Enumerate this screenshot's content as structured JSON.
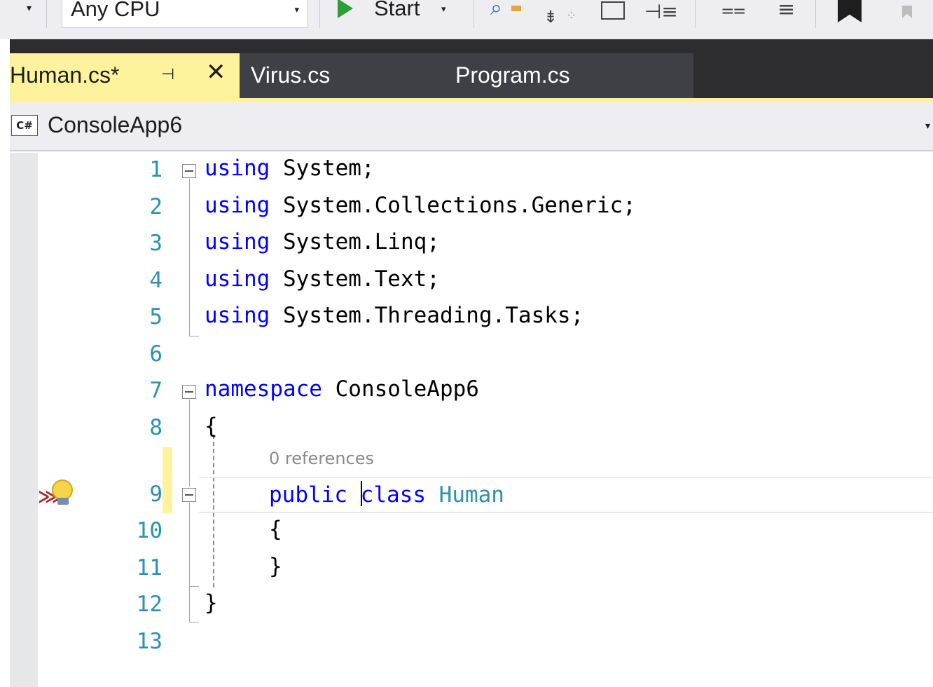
{
  "toolbar": {
    "platform_label": "Any CPU",
    "start_label": "Start",
    "dropdown_glyph": "▾",
    "icons": [
      "config-dropdown-icon",
      "find-icon",
      "format-document-icon",
      "comment-icon",
      "uncomment-icon",
      "outdent-icon",
      "indent-icon",
      "bookmark-icon",
      "bookmark-next-icon"
    ]
  },
  "tabs": [
    {
      "label": "Human.cs*",
      "active": true,
      "pinned": false
    },
    {
      "label": "Virus.cs",
      "active": false
    },
    {
      "label": "Program.cs",
      "active": false
    }
  ],
  "tab_glyphs": {
    "pin": "⊣",
    "close": "✕"
  },
  "navbar": {
    "project_label": "ConsoleApp6",
    "language_badge": "C#",
    "arrow_glyph": "▾"
  },
  "editor": {
    "codelens_text": "0 references",
    "line_numbers": [
      "1",
      "2",
      "3",
      "4",
      "5",
      "6",
      "7",
      "8",
      "9",
      "10",
      "11",
      "12",
      "13"
    ],
    "lines": [
      {
        "kw": "using",
        "rest": " System;"
      },
      {
        "kw": "using",
        "rest": " System.Collections.Generic;"
      },
      {
        "kw": "using",
        "rest": " System.Linq;"
      },
      {
        "kw": "using",
        "rest": " System.Text;"
      },
      {
        "kw": "using",
        "rest": " System.Threading.Tasks;"
      },
      {
        "kw": "",
        "rest": ""
      },
      {
        "kw": "namespace",
        "rest": " ConsoleApp6"
      },
      {
        "kw": "",
        "rest": "{"
      },
      {
        "kw": "public",
        "kw2a": "c",
        "kw2b": "lass",
        "type": "Human"
      },
      {
        "kw": "",
        "rest": "{"
      },
      {
        "kw": "",
        "rest": "}"
      },
      {
        "kw": "",
        "rest": "}"
      },
      {
        "kw": "",
        "rest": ""
      }
    ]
  },
  "colors": {
    "keyword": "#0000ff",
    "type": "#2b91af",
    "line_number": "#2b91af",
    "active_tab": "#fff29d",
    "tab_strip": "#2d2d30",
    "change_marker": "#fff29d"
  }
}
